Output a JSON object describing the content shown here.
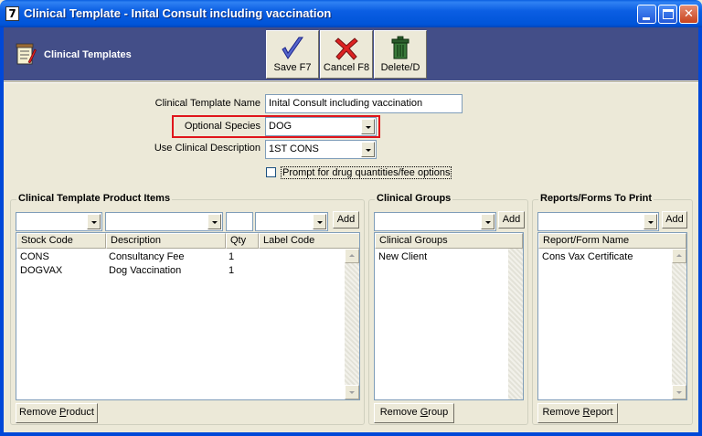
{
  "window": {
    "icon_glyph": "7",
    "title": "Clinical Template - Inital Consult including vaccination"
  },
  "header": {
    "title": "Clinical Templates",
    "icon": "notepad-icon",
    "toolbar": {
      "save_label": "Save F7",
      "cancel_label": "Cancel F8",
      "delete_label": "Delete/D"
    }
  },
  "form": {
    "name_label": "Clinical Template Name",
    "name_value": "Inital Consult including vaccination",
    "species_label": "Optional Species",
    "species_value": "DOG",
    "desc_label": "Use Clinical Description",
    "desc_value": "1ST CONS",
    "prompt_checked": false,
    "prompt_label": "Prompt for drug quantities/fee options"
  },
  "products": {
    "title": "Clinical Template Product Items",
    "add_label": "Add",
    "columns": [
      "Stock Code",
      "Description",
      "Qty",
      "Label Code"
    ],
    "rows": [
      {
        "stock_code": "CONS",
        "description": "Consultancy Fee",
        "qty": "1",
        "label_code": ""
      },
      {
        "stock_code": "DOGVAX",
        "description": "Dog Vaccination",
        "qty": "1",
        "label_code": ""
      }
    ],
    "remove_prefix": "Remove ",
    "remove_accel": "P",
    "remove_suffix": "roduct"
  },
  "groups": {
    "title": "Clinical Groups",
    "add_label": "Add",
    "column": "Clinical Groups",
    "rows": [
      "New Client"
    ],
    "remove_prefix": "Remove ",
    "remove_accel": "G",
    "remove_suffix": "roup"
  },
  "reports": {
    "title": "Reports/Forms To Print",
    "add_label": "Add",
    "column": "Report/Form Name",
    "rows": [
      "Cons Vax Certificate"
    ],
    "remove_prefix": "Remove ",
    "remove_accel": "R",
    "remove_suffix": "eport"
  },
  "colors": {
    "header_bg": "#434e88",
    "highlight": "#e0151b",
    "titlebar": "#0054d8"
  }
}
